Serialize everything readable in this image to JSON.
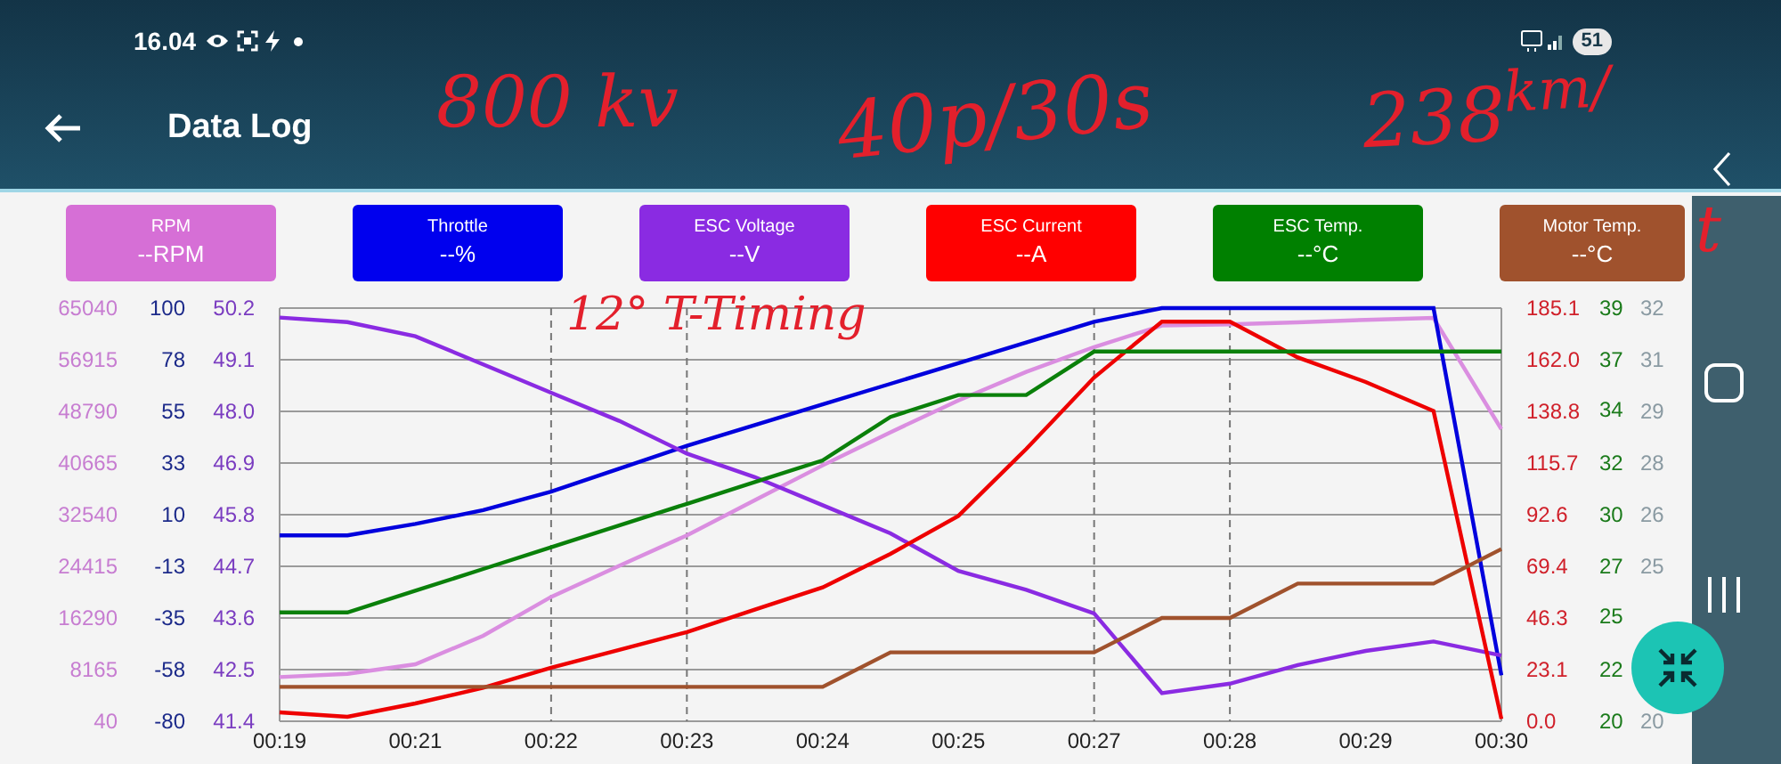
{
  "status_bar": {
    "time": "16.04",
    "battery": "51"
  },
  "app_bar": {
    "title": "Data Log"
  },
  "channels": [
    {
      "label": "RPM",
      "value": "--RPM",
      "color": "#d66fd6"
    },
    {
      "label": "Throttle",
      "value": "--%",
      "color": "#0000ee"
    },
    {
      "label": "ESC Voltage",
      "value": "--V",
      "color": "#8a2be2"
    },
    {
      "label": "ESC Current",
      "value": "--A",
      "color": "#ff0000"
    },
    {
      "label": "ESC Temp.",
      "value": "--°C",
      "color": "#008000"
    },
    {
      "label": "Motor Temp.",
      "value": "--°C",
      "color": "#a0522d"
    }
  ],
  "charts": [
    {
      "chart_data": {
        "type": "line",
        "grid": true,
        "x": [
          19.4,
          20.0,
          20.6,
          21.2,
          21.8,
          22.4,
          23.0,
          23.6,
          24.2,
          24.8,
          25.4,
          26.0,
          26.6,
          27.2,
          27.8,
          28.4,
          29.0,
          29.6,
          30.2
        ],
        "xlim": [
          19.4,
          30.2
        ],
        "xticks": [
          {
            "value": 19.4,
            "label": "00:19"
          },
          {
            "value": 20.6,
            "label": "00:21"
          },
          {
            "value": 21.8,
            "label": "00:22"
          },
          {
            "value": 23.0,
            "label": "00:23"
          },
          {
            "value": 24.2,
            "label": "00:24"
          },
          {
            "value": 25.4,
            "label": "00:25"
          },
          {
            "value": 26.6,
            "label": "00:27"
          },
          {
            "value": 27.8,
            "label": "00:28"
          },
          {
            "value": 29.0,
            "label": "00:29"
          },
          {
            "value": 30.2,
            "label": "00:30"
          }
        ],
        "ylim": [
          40,
          65040
        ],
        "yticks": [
          65040,
          56915,
          48790,
          40665,
          32540,
          24415,
          16290,
          8165,
          40
        ],
        "series": [
          {
            "color": "#da8ee0",
            "values": [
              7000,
              7500,
              9000,
              13500,
              19600,
              24500,
              29300,
              34800,
              40300,
              45500,
              50500,
              55000,
              58900,
              62300,
              62500,
              62800,
              63200,
              63500,
              46000
            ]
          }
        ]
      }
    },
    {
      "chart_data": {
        "type": "line",
        "x": [
          19.4,
          20.0,
          20.6,
          21.2,
          21.8,
          22.4,
          23.0,
          23.6,
          24.2,
          24.8,
          25.4,
          26.0,
          26.6,
          27.2,
          27.8,
          28.4,
          29.0,
          29.6,
          30.2
        ],
        "xlim": [
          19.4,
          30.2
        ],
        "ylim": [
          -80,
          100
        ],
        "yticks": [
          100,
          {
            "value": 77.5,
            "label": "78"
          },
          {
            "value": 55,
            "label": "55"
          },
          {
            "value": 32.5,
            "label": "33"
          },
          10,
          {
            "value": -12.5,
            "label": "-13"
          },
          -35,
          {
            "value": -57.5,
            "label": "-58"
          },
          -80
        ],
        "series": [
          {
            "color": "#0000dd",
            "values": [
              1,
              1,
              6,
              12,
              20,
              30,
              40,
              49,
              58,
              67,
              76,
              85,
              94,
              100,
              100,
              100,
              100,
              100,
              -60
            ]
          }
        ]
      }
    },
    {
      "chart_data": {
        "type": "line",
        "x": [
          19.4,
          20.0,
          20.6,
          21.2,
          21.8,
          22.4,
          23.0,
          23.6,
          24.2,
          24.8,
          25.4,
          26.0,
          26.6,
          27.2,
          27.8,
          28.4,
          29.0,
          29.6,
          30.2
        ],
        "xlim": [
          19.4,
          30.2
        ],
        "ylim": [
          41.4,
          50.2
        ],
        "yticks": [
          {
            "value": 50.2,
            "label": "50.2"
          },
          {
            "value": 49.1,
            "label": "49.1"
          },
          {
            "value": 48.0,
            "label": "48.0"
          },
          {
            "value": 46.9,
            "label": "46.9"
          },
          {
            "value": 45.8,
            "label": "45.8"
          },
          {
            "value": 44.7,
            "label": "44.7"
          },
          {
            "value": 43.6,
            "label": "43.6"
          },
          {
            "value": 42.5,
            "label": "42.5"
          },
          {
            "value": 41.4,
            "label": "41.4"
          }
        ],
        "series": [
          {
            "color": "#8a2be2",
            "values": [
              50.0,
              49.9,
              49.6,
              49.0,
              48.4,
              47.8,
              47.1,
              46.6,
              46.0,
              45.4,
              44.6,
              44.2,
              43.7,
              42.0,
              42.2,
              42.6,
              42.9,
              43.1,
              42.8
            ]
          }
        ]
      }
    },
    {
      "chart_data": {
        "type": "line",
        "x": [
          19.4,
          20.0,
          20.6,
          21.2,
          21.8,
          22.4,
          23.0,
          23.6,
          24.2,
          24.8,
          25.4,
          26.0,
          26.6,
          27.2,
          27.8,
          28.4,
          29.0,
          29.6,
          30.2
        ],
        "xlim": [
          19.4,
          30.2
        ],
        "ylim": [
          0,
          185.1
        ],
        "yticks": [
          {
            "value": 185.1,
            "label": "185.1"
          },
          {
            "value": 162.0,
            "label": "162.0"
          },
          {
            "value": 138.8,
            "label": "138.8"
          },
          {
            "value": 115.7,
            "label": "115.7"
          },
          {
            "value": 92.6,
            "label": "92.6"
          },
          {
            "value": 69.4,
            "label": "69.4"
          },
          {
            "value": 46.3,
            "label": "46.3"
          },
          {
            "value": 23.1,
            "label": "23.1"
          },
          {
            "value": 0,
            "label": "0.0"
          }
        ],
        "series": [
          {
            "color": "#ee0000",
            "values": [
              4,
              2,
              8,
              15,
              24,
              32,
              40,
              50,
              60,
              75,
              92,
              122,
              154,
              179,
              179,
              163,
              152,
              139,
              1
            ]
          }
        ]
      }
    },
    {
      "chart_data": {
        "type": "line",
        "x": [
          19.4,
          20.0,
          20.6,
          21.2,
          21.8,
          22.4,
          23.0,
          23.6,
          24.2,
          24.8,
          25.4,
          26.0,
          26.6,
          27.2,
          27.8,
          28.4,
          29.0,
          29.6,
          30.2
        ],
        "xlim": [
          19.4,
          30.2
        ],
        "ylim": [
          20,
          39
        ],
        "yticks": [
          39,
          {
            "value": 36.6,
            "label": "37"
          },
          {
            "value": 34.3,
            "label": "34"
          },
          {
            "value": 31.9,
            "label": "32"
          },
          {
            "value": 29.5,
            "label": "30"
          },
          {
            "value": 27.1,
            "label": "27"
          },
          {
            "value": 24.8,
            "label": "25"
          },
          {
            "value": 22.4,
            "label": "22"
          },
          20
        ],
        "series": [
          {
            "color": "#0a800a",
            "values": [
              25,
              25,
              26,
              27,
              28,
              29,
              30,
              31,
              32,
              34,
              35,
              35,
              37,
              37,
              37,
              37,
              37,
              37,
              37
            ]
          }
        ]
      }
    },
    {
      "chart_data": {
        "type": "line",
        "x": [
          19.4,
          20.0,
          20.6,
          21.2,
          21.8,
          22.4,
          23.0,
          23.6,
          24.2,
          24.8,
          25.4,
          26.0,
          26.6,
          27.2,
          27.8,
          28.4,
          29.0,
          29.6,
          30.2
        ],
        "xlim": [
          19.4,
          30.2
        ],
        "ylim": [
          20,
          32
        ],
        "yticks": [
          32,
          {
            "value": 30.5,
            "label": "31"
          },
          29,
          {
            "value": 27.5,
            "label": "28"
          },
          26,
          {
            "value": 24.5,
            "label": "25"
          },
          20
        ],
        "series": [
          {
            "color": "#a0522d",
            "values": [
              21,
              21,
              21,
              21,
              21,
              21,
              21,
              21,
              21,
              22,
              22,
              22,
              22,
              23,
              23,
              24,
              24,
              24,
              25
            ]
          }
        ]
      }
    }
  ],
  "handwriting": [
    {
      "text": "800 kv"
    },
    {
      "text": "40p/30s"
    },
    {
      "text": "238$^{km/}$"
    },
    {
      "text": "t"
    },
    {
      "text": "12° T-Timing"
    }
  ]
}
